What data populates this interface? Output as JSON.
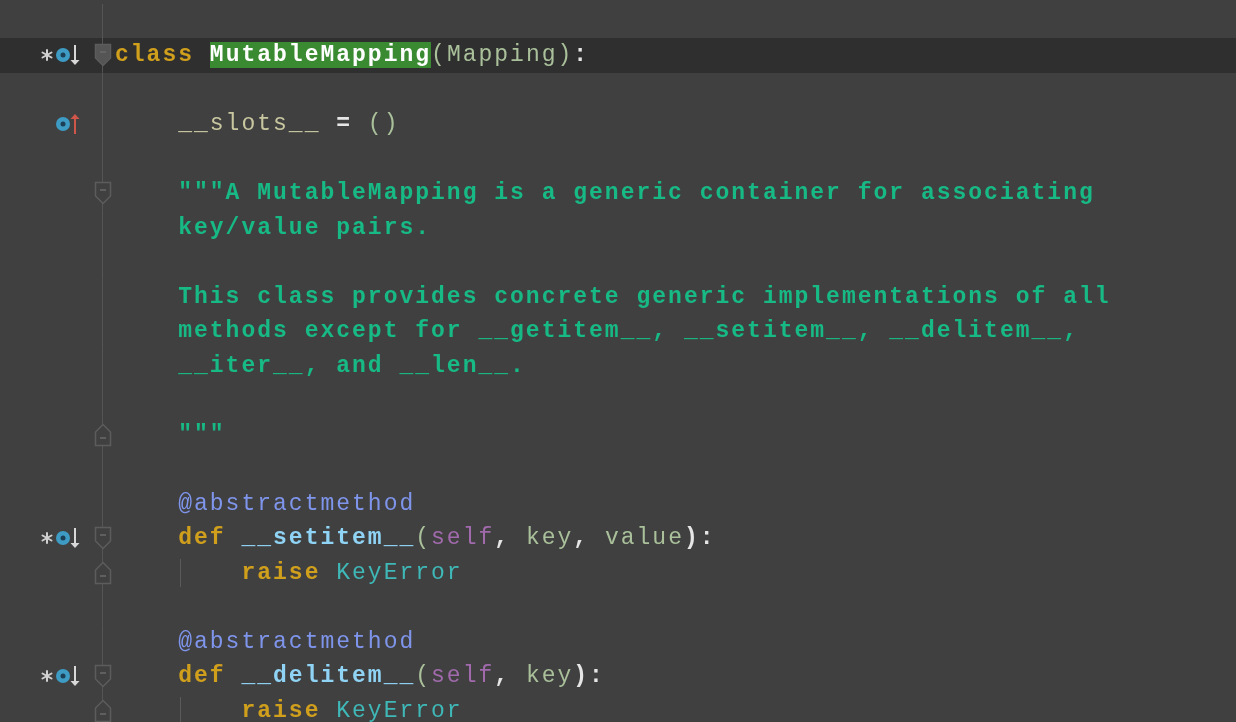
{
  "lines": [
    {
      "kind": "blank"
    },
    {
      "kind": "code",
      "current": true,
      "modified": true,
      "overrides": true,
      "fold_start": true,
      "tokens": [
        {
          "text": "class ",
          "kind": "keyword"
        },
        {
          "text": "MutableMapping",
          "kind": "highlight"
        },
        {
          "text": "(",
          "kind": "paren"
        },
        {
          "text": "Mapping",
          "kind": "ref"
        },
        {
          "text": ")",
          "kind": "paren"
        },
        {
          "text": ":",
          "kind": "punct"
        }
      ]
    },
    {
      "kind": "blank"
    },
    {
      "kind": "code",
      "overridden": true,
      "tokens": [
        {
          "text": "    __slots__",
          "kind": "field"
        },
        {
          "text": " = ",
          "kind": "punct"
        },
        {
          "text": "()",
          "kind": "paren"
        }
      ]
    },
    {
      "kind": "blank"
    },
    {
      "kind": "code",
      "fold_start": true,
      "tokens": [
        {
          "text": "    \"\"\"A MutableMapping is a generic container for associating",
          "kind": "doc"
        }
      ]
    },
    {
      "kind": "code",
      "tokens": [
        {
          "text": "    key/value pairs.",
          "kind": "doc"
        }
      ]
    },
    {
      "kind": "blank"
    },
    {
      "kind": "code",
      "tokens": [
        {
          "text": "    This class provides concrete generic implementations of all",
          "kind": "doc"
        }
      ]
    },
    {
      "kind": "code",
      "tokens": [
        {
          "text": "    methods except for __getitem__, __setitem__, __delitem__,",
          "kind": "doc"
        }
      ]
    },
    {
      "kind": "code",
      "tokens": [
        {
          "text": "    __iter__, and __len__.",
          "kind": "doc"
        }
      ]
    },
    {
      "kind": "blank"
    },
    {
      "kind": "code",
      "fold_end": true,
      "tokens": [
        {
          "text": "    \"\"\"",
          "kind": "doc"
        }
      ]
    },
    {
      "kind": "blank"
    },
    {
      "kind": "code",
      "tokens": [
        {
          "text": "    @abstractmethod",
          "kind": "decorator"
        }
      ]
    },
    {
      "kind": "code",
      "modified": true,
      "overrides": true,
      "fold_start": true,
      "tokens": [
        {
          "text": "    def ",
          "kind": "keyword"
        },
        {
          "text": "__setitem__",
          "kind": "func"
        },
        {
          "text": "(",
          "kind": "paren"
        },
        {
          "text": "self",
          "kind": "self"
        },
        {
          "text": ", ",
          "kind": "punct"
        },
        {
          "text": "key",
          "kind": "ref"
        },
        {
          "text": ", ",
          "kind": "punct"
        },
        {
          "text": "value",
          "kind": "ref"
        },
        {
          "text": "):",
          "kind": "punct"
        }
      ]
    },
    {
      "kind": "code",
      "fold_end": true,
      "indent_guide": true,
      "tokens": [
        {
          "text": "        raise ",
          "kind": "keyword"
        },
        {
          "text": "KeyError",
          "kind": "builtin"
        }
      ]
    },
    {
      "kind": "blank"
    },
    {
      "kind": "code",
      "tokens": [
        {
          "text": "    @abstractmethod",
          "kind": "decorator"
        }
      ]
    },
    {
      "kind": "code",
      "modified": true,
      "overrides": true,
      "fold_start": true,
      "tokens": [
        {
          "text": "    def ",
          "kind": "keyword"
        },
        {
          "text": "__delitem__",
          "kind": "func"
        },
        {
          "text": "(",
          "kind": "paren"
        },
        {
          "text": "self",
          "kind": "self"
        },
        {
          "text": ", ",
          "kind": "punct"
        },
        {
          "text": "key",
          "kind": "ref"
        },
        {
          "text": "):",
          "kind": "punct"
        }
      ]
    },
    {
      "kind": "code",
      "fold_end": true,
      "indent_guide": true,
      "tokens": [
        {
          "text": "        raise ",
          "kind": "keyword"
        },
        {
          "text": "KeyError",
          "kind": "builtin"
        }
      ]
    }
  ]
}
